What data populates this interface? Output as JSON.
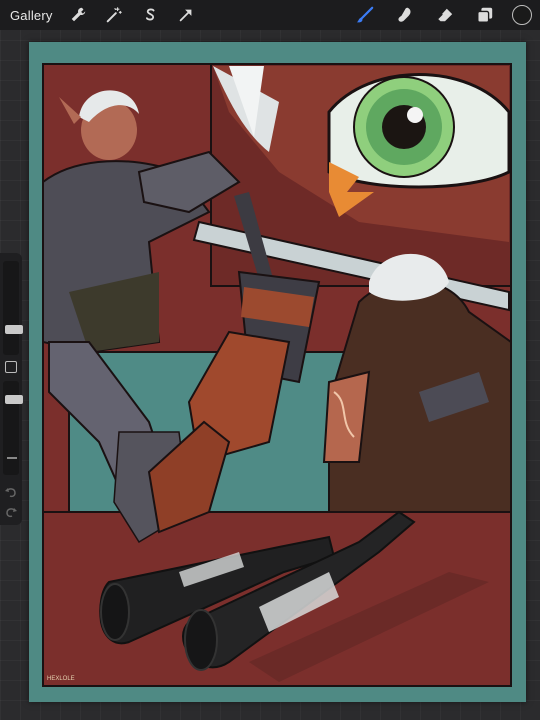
{
  "topbar": {
    "gallery_label": "Gallery",
    "left_tools": [
      "wrench-icon",
      "magic-wand-icon",
      "selection-s-icon",
      "transform-arrow-icon"
    ],
    "right_tools": [
      "brush-icon",
      "smudge-icon",
      "eraser-icon",
      "layers-icon"
    ],
    "active_tool": "brush-icon",
    "current_color": "#1a1a1a",
    "accent_color": "#3b7cf5"
  },
  "sidebar": {
    "brush_size_level": 0.72,
    "opacity_level": 0.35
  },
  "artwork": {
    "signature": "HEXLOLE",
    "colors": {
      "border_teal": "#4f8a84",
      "panel_red": "#7b2f2c",
      "panel_teal": "#4f8b86",
      "skin": "#b5674e",
      "hair": "#e6e9ea",
      "armor": "#5b5a62",
      "bottle": "#202021"
    }
  }
}
